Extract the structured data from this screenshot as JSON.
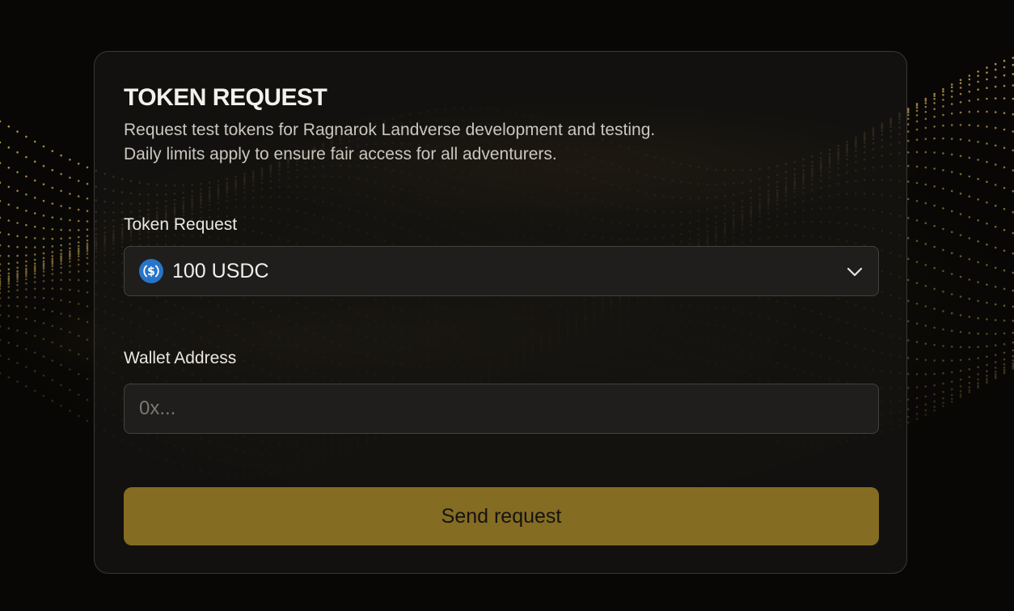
{
  "form": {
    "title": "TOKEN REQUEST",
    "subtitle_line1": "Request test tokens for Ragnarok Landverse development and testing.",
    "subtitle_line2": "Daily limits apply to ensure fair access for all adventurers.",
    "token_label": "Token Request",
    "token_select": {
      "value": "100 USDC",
      "icon": "usdc-icon"
    },
    "wallet_label": "Wallet Address",
    "wallet_input": {
      "value": "",
      "placeholder": "0x..."
    },
    "submit_label": "Send request"
  },
  "colors": {
    "accent": "#846c22",
    "card_border": "#3a3836",
    "field_bg": "#1f1e1c",
    "usdc_blue": "#2775ca"
  }
}
